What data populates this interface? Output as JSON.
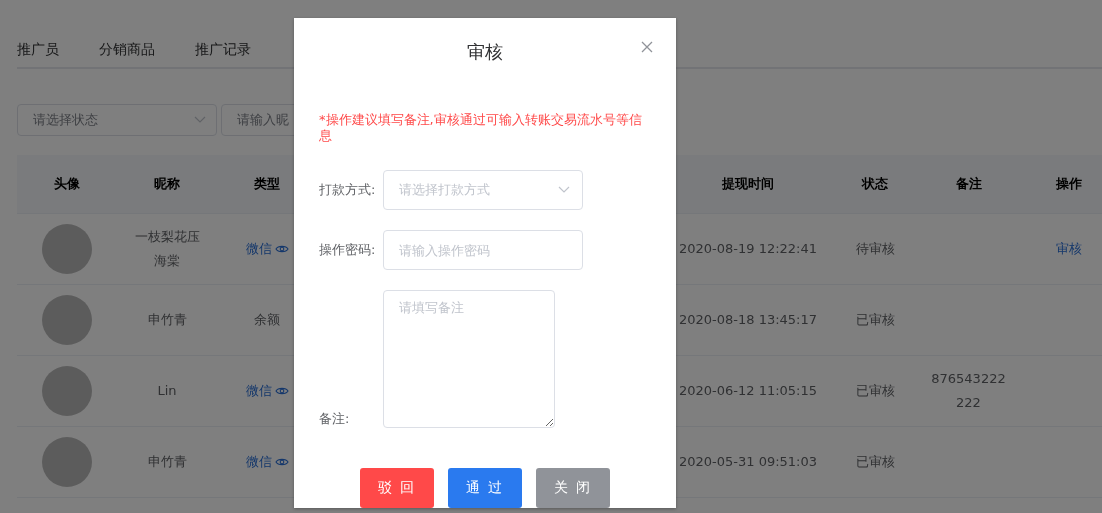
{
  "tabs": [
    {
      "label": "推广员",
      "selected": false
    },
    {
      "label": "分销商品",
      "selected": false
    },
    {
      "label": "推广记录",
      "selected": false
    }
  ],
  "filters": {
    "status_select": {
      "placeholder": "请选择状态"
    },
    "nickname_field": {
      "placeholder": "请输入昵"
    }
  },
  "table": {
    "columns_left": [
      "头像",
      "昵称",
      "类型"
    ],
    "columns_right": [
      "提现时间",
      "状态",
      "备注",
      "操作"
    ],
    "rows": [
      {
        "nickname": "一枝梨花压海棠",
        "type": {
          "label": "微信",
          "linked": true
        },
        "time": "2020-08-19 12:22:41",
        "status": "待审核",
        "note": "",
        "action": "审核"
      },
      {
        "nickname": "申竹青",
        "type": {
          "label": "余额",
          "linked": false
        },
        "time": "2020-08-18 13:45:17",
        "status": "已审核",
        "note": "",
        "action": ""
      },
      {
        "nickname": "Lin",
        "type": {
          "label": "微信",
          "linked": true
        },
        "time": "2020-06-12 11:05:15",
        "status": "已审核",
        "note": "876543222222",
        "action": ""
      },
      {
        "nickname": "申竹青",
        "type": {
          "label": "微信",
          "linked": true
        },
        "time": "2020-05-31 09:51:03",
        "status": "已审核",
        "note": "",
        "action": ""
      }
    ]
  },
  "dialog": {
    "title": "审核",
    "notice": "*操作建议填写备注,审核通过可输入转账交易流水号等信息",
    "fields": [
      {
        "kind": "select",
        "label": "打款方式:",
        "placeholder": "请选择打款方式"
      },
      {
        "kind": "input",
        "label": "操作密码:",
        "placeholder": "请输入操作密码"
      },
      {
        "kind": "textarea",
        "label": "备注:",
        "placeholder": "请填写备注"
      }
    ],
    "buttons": [
      {
        "label": "驳 回",
        "kind": "danger"
      },
      {
        "label": "通 过",
        "kind": "primary"
      },
      {
        "label": "关 闭",
        "kind": "neutral"
      }
    ]
  }
}
